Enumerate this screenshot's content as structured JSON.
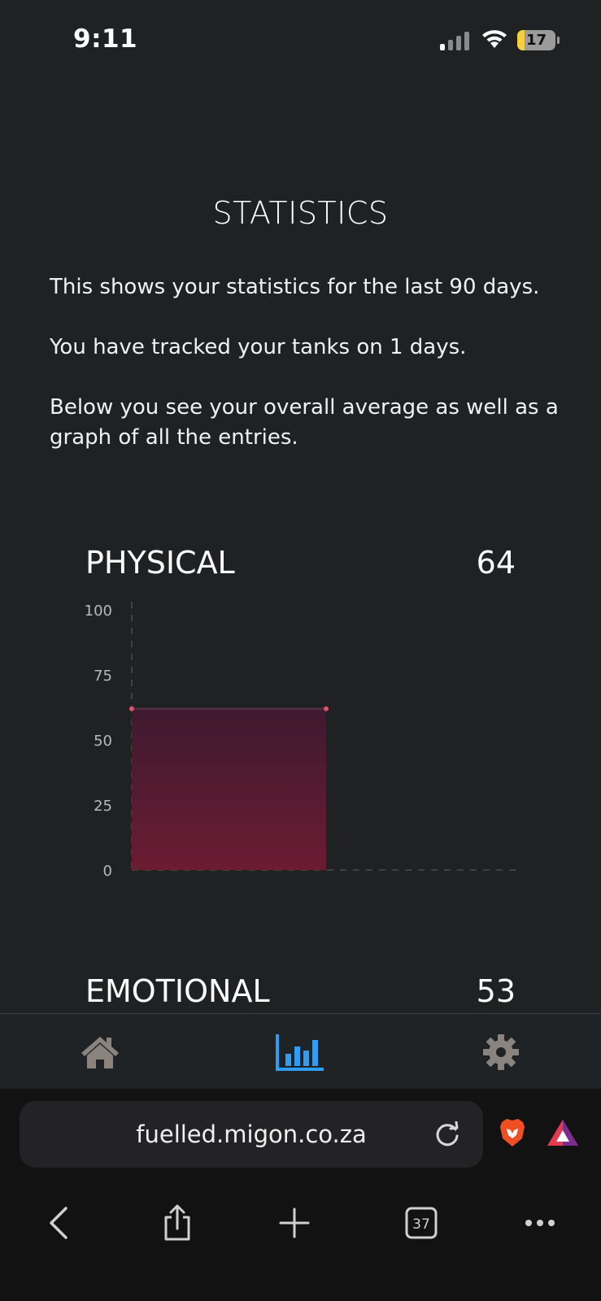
{
  "status_bar": {
    "time": "9:11",
    "battery": "17"
  },
  "page": {
    "title": "STATISTICS",
    "intro": [
      "This shows your statistics for the last 90 days.",
      "You have tracked your tanks on 1 days.",
      "Below you see your overall average as well as a graph of all the entries."
    ]
  },
  "sections": [
    {
      "label": "PHYSICAL",
      "value": "64"
    },
    {
      "label": "EMOTIONAL",
      "value": "53"
    }
  ],
  "chart_data": {
    "type": "area",
    "x": [
      1,
      2
    ],
    "series": [
      {
        "values": [
          62,
          62
        ]
      }
    ],
    "ylim": [
      0,
      100
    ],
    "yticks": [
      "100",
      "75",
      "50",
      "25",
      "0"
    ],
    "grid": true,
    "fill_top_color": "#3e1a30",
    "fill_bottom_color": "#6b1c32",
    "point_color": "#e0506a"
  },
  "bottom_nav": {
    "items": [
      {
        "icon": "home-icon"
      },
      {
        "icon": "bar-chart-icon",
        "active": true
      },
      {
        "icon": "gear-icon"
      }
    ],
    "active_color": "#2e9df3",
    "inactive_color": "#8b847e"
  },
  "browser": {
    "url": "fuelled.migon.co.za",
    "tab_count": "37"
  }
}
